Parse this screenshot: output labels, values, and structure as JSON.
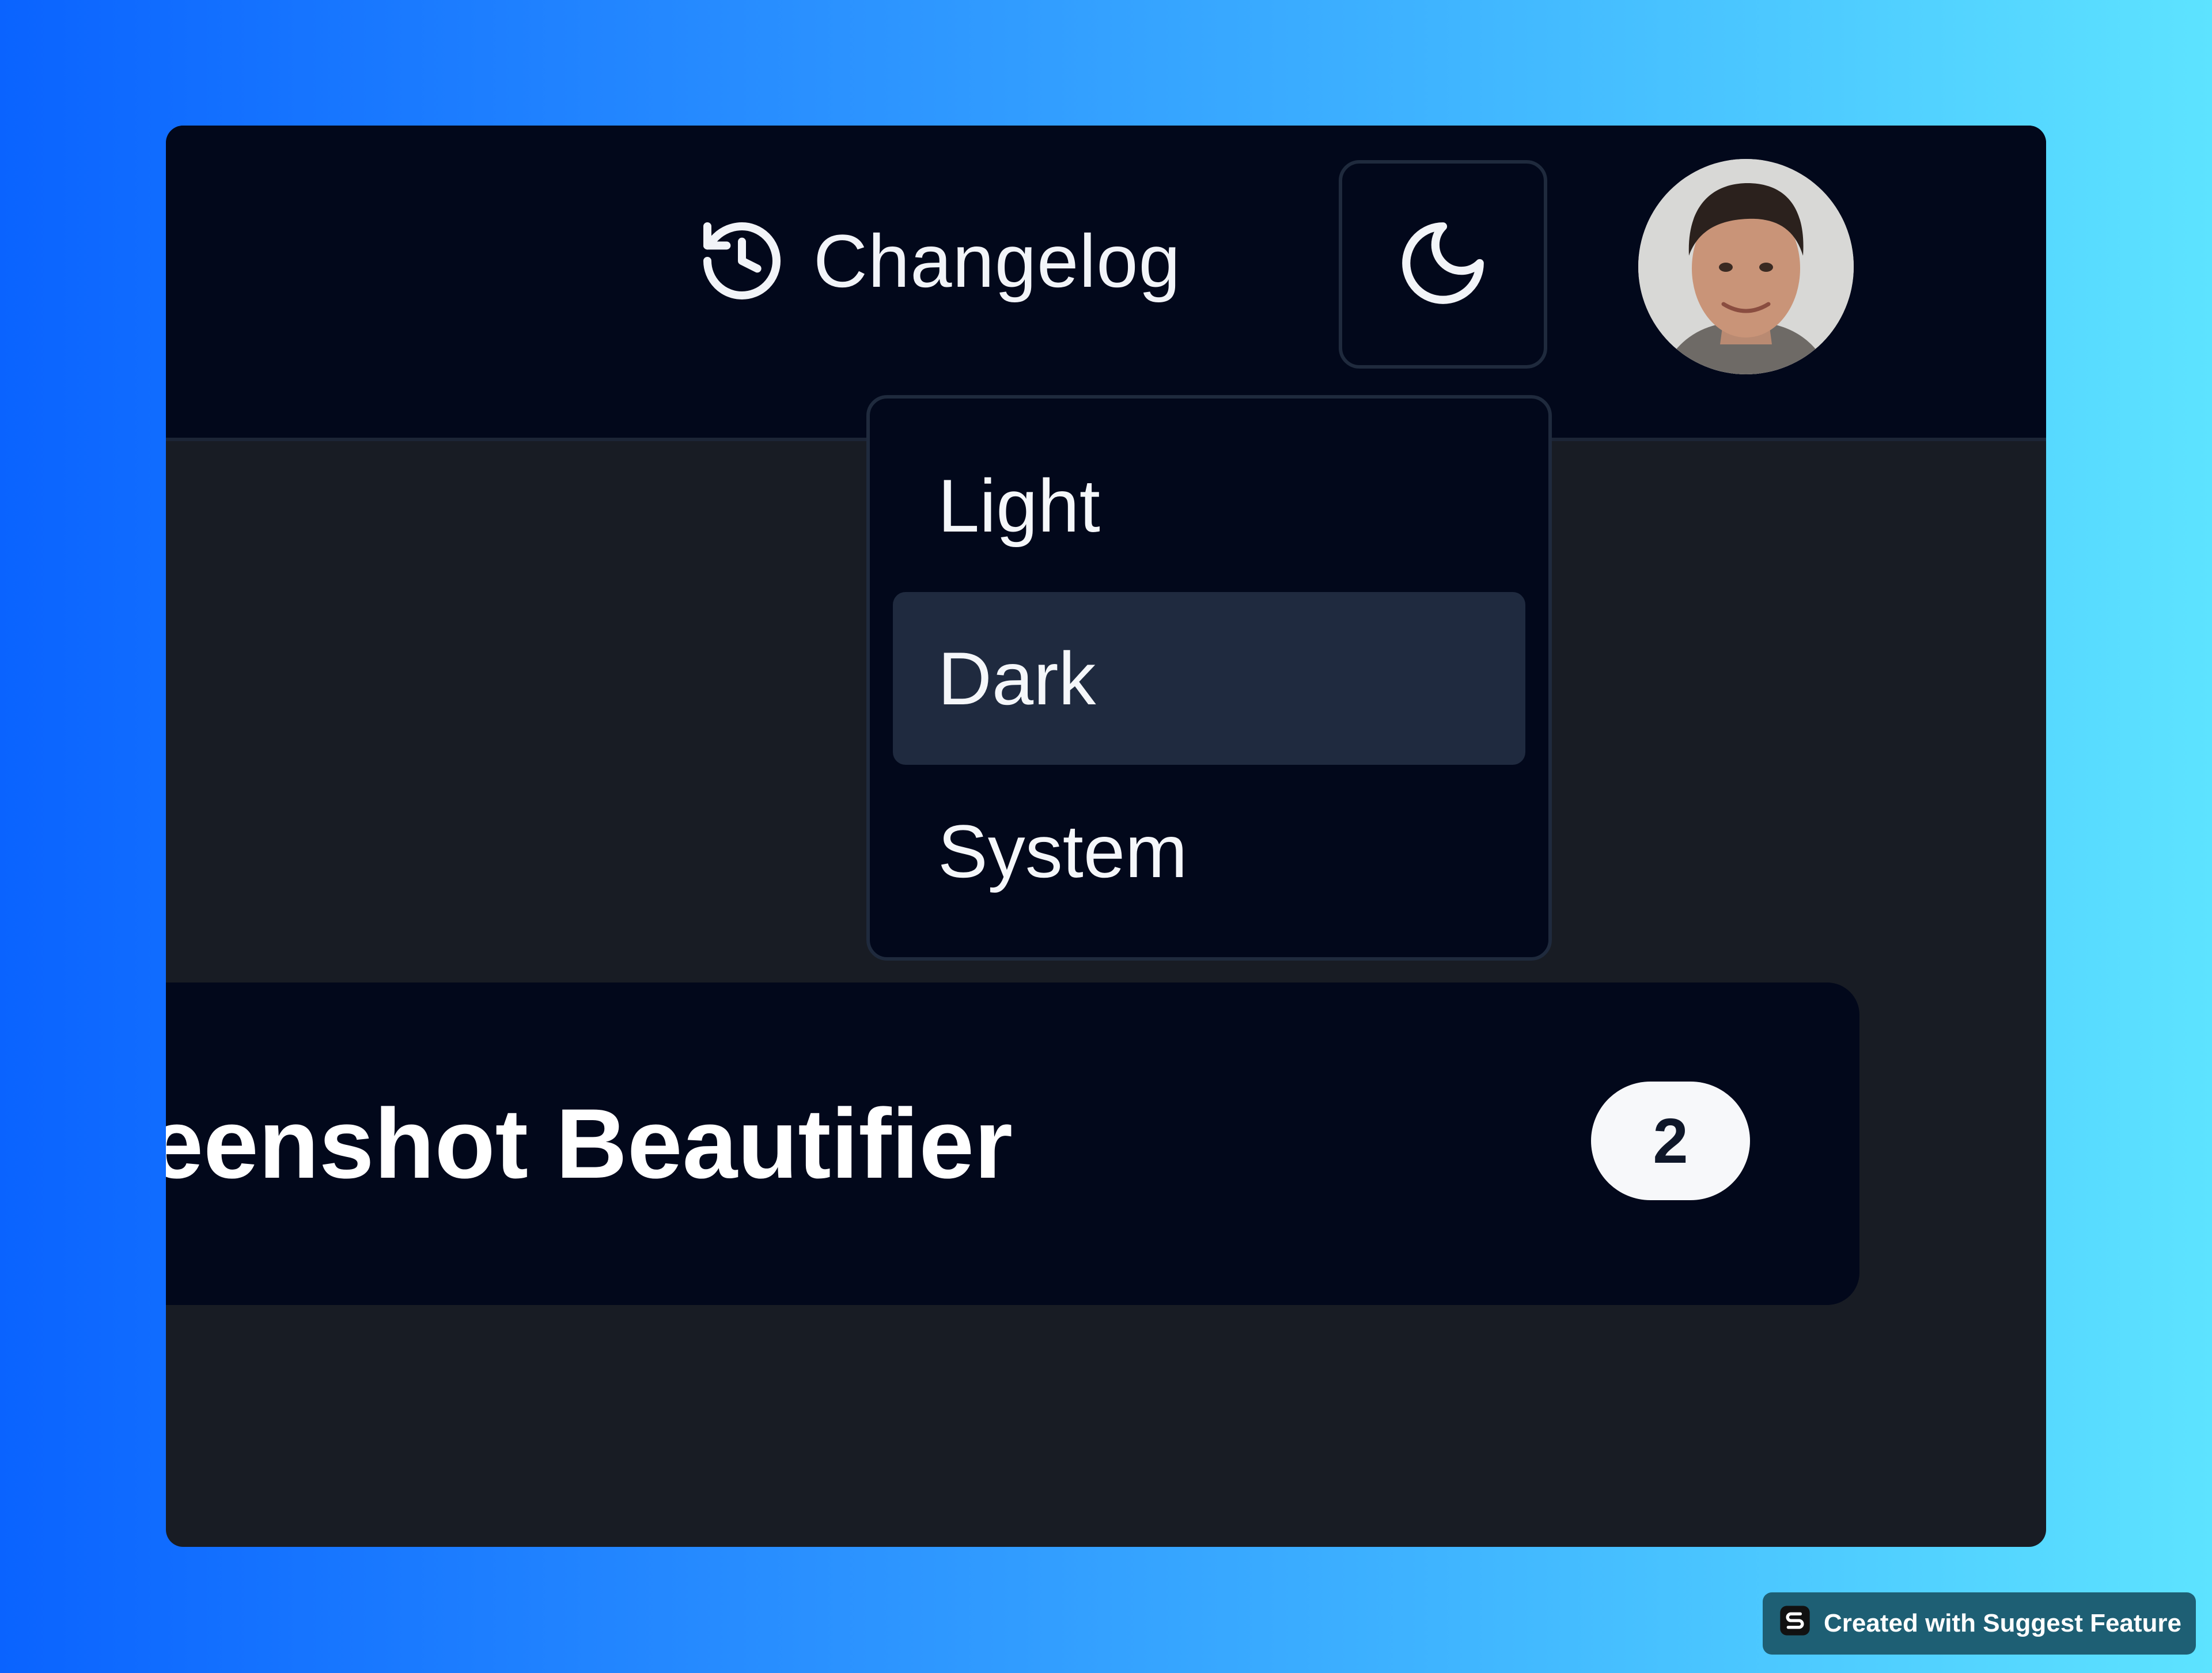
{
  "colors": {
    "page_gradient_start": "#0a63ff",
    "page_gradient_end": "#5de3ff",
    "header_background": "#02081b",
    "content_background": "#181c24",
    "menu_active_background": "#1f2a3f",
    "text_primary": "#ffffff",
    "badge_background": "#f7f8fa"
  },
  "header": {
    "changelog_label": "Changelog",
    "changelog_icon": "history-icon",
    "theme_toggle_icon": "moon-icon",
    "avatar_icon": "user-avatar"
  },
  "theme_menu": {
    "items": [
      {
        "label": "Light"
      },
      {
        "label": "Dark"
      },
      {
        "label": "System"
      }
    ],
    "selected": "Dark"
  },
  "card": {
    "title": "Screenshot Beautifier",
    "count": "2"
  },
  "watermark": {
    "text": "Created with Suggest Feature",
    "icon": "suggest-feature-logo"
  }
}
